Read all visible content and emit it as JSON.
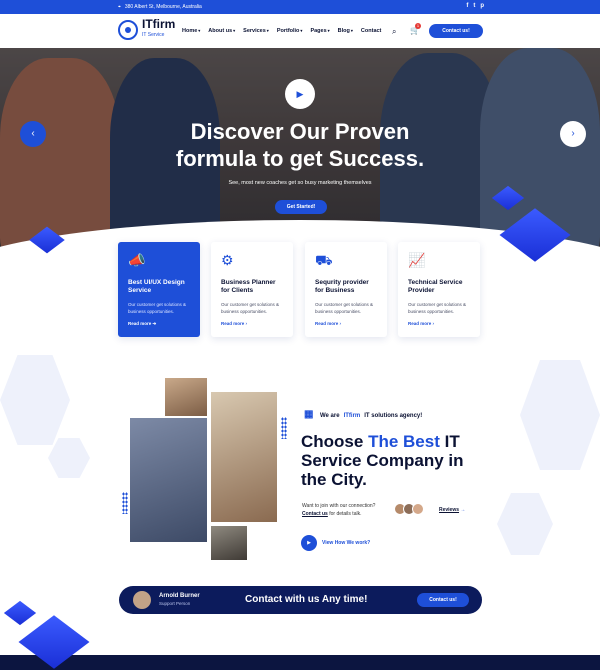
{
  "topbar": {
    "address": "380 Albert St, Melbourne, Australia",
    "social": [
      "f",
      "t",
      "p"
    ]
  },
  "nav": {
    "brand": "ITfirm",
    "brand_sub": "IT Service",
    "menu": [
      "Home",
      "About us",
      "Services",
      "Portfolio",
      "Pages",
      "Blog",
      "Contact"
    ],
    "cart_count": "1",
    "contact_button": "Contact us!"
  },
  "hero": {
    "title_line1": "Discover Our Proven",
    "title_line2": "formula to get Success.",
    "subtitle": "See, most new coaches get so busy marketing themselves",
    "cta": "Get Started!"
  },
  "services": [
    {
      "title": "Best UI/UX Design Service",
      "text": "Our customer get solutions & business opportunities.",
      "more": "Read more",
      "icon": "megaphone-icon",
      "glyph": "📣"
    },
    {
      "title": "Business Planner for Clients",
      "text": "Our customer get solutions & business opportunities.",
      "more": "Read more",
      "icon": "gear-icon",
      "glyph": "⚙"
    },
    {
      "title": "Sequrity provider for Business",
      "text": "Our customer get solutions & business opportunities.",
      "more": "Read more",
      "icon": "truck-icon",
      "glyph": "⛟"
    },
    {
      "title": "Technical Service Provider",
      "text": "Our customer get solutions & business opportunities.",
      "more": "Read more",
      "icon": "chart-board-icon",
      "glyph": "📈"
    }
  ],
  "about": {
    "tag_prefix": "We are",
    "tag_brand": "ITfirm",
    "tag_suffix": "IT solutions agency!",
    "heading_pre": "Choose",
    "heading_highlight": "The Best",
    "heading_post": "IT Service Company in the City.",
    "join_text": "Want to join with our connection?",
    "contact_link": "Contact us",
    "contact_suffix": "for details talk.",
    "reviews_label": "Reviews",
    "video_label": "View How We work?"
  },
  "contact_bar": {
    "name": "Arnold Burner",
    "role": "Support Person",
    "message": "Contact with us Any time!",
    "button": "Contact us!"
  },
  "colors": {
    "primary": "#1e4fd8",
    "navy": "#0c1b5c",
    "text": "#0b1233"
  }
}
